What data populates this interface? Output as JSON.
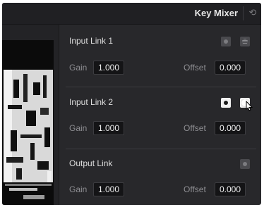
{
  "header": {
    "title": "Key Mixer",
    "reset_icon": "reset-icon"
  },
  "links": [
    {
      "title": "Input Link 1",
      "gain_label": "Gain",
      "gain_value": "1.000",
      "offset_label": "Offset",
      "offset_value": "0.000",
      "mode_buttons": [
        "dot-mode-icon",
        "striped-mode-icon"
      ]
    },
    {
      "title": "Input Link 2",
      "gain_label": "Gain",
      "gain_value": "1.000",
      "offset_label": "Offset",
      "offset_value": "0.000",
      "mode_buttons": [
        "dot-mode-icon",
        "glow-mode-icon"
      ]
    },
    {
      "title": "Output Link",
      "gain_label": "Gain",
      "gain_value": "1.000",
      "offset_label": "Offset",
      "offset_value": "0.000",
      "mode_buttons": [
        "dot-mode-icon"
      ]
    }
  ],
  "colors": {
    "panel_bg": "#28282b",
    "field_bg": "#141416",
    "text": "#dedede",
    "label": "#8e8e92"
  }
}
